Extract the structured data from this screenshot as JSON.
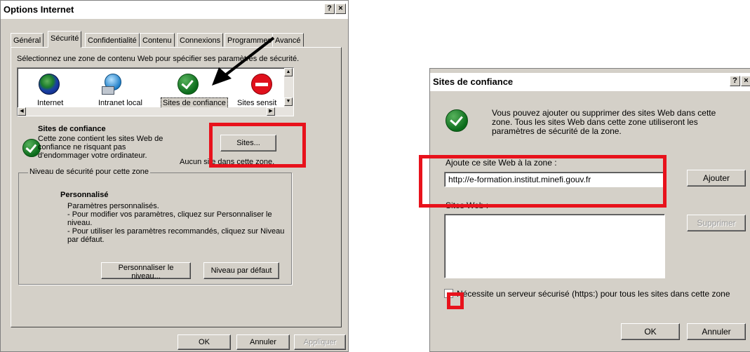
{
  "options_dialog": {
    "title": "Options Internet",
    "help_btn": "?",
    "close_btn": "×",
    "tabs": [
      "Général",
      "Sécurité",
      "Confidentialité",
      "Contenu",
      "Connexions",
      "Programmes",
      "Avancé"
    ],
    "active_tab": "Sécurité",
    "zone_instruction": "Sélectionnez une zone de contenu Web pour spécifier ses paramètres de sécurité.",
    "zones": [
      "Internet",
      "Intranet local",
      "Sites de confiance",
      "Sites sensit"
    ],
    "selected_zone": "Sites de confiance",
    "zone_heading": "Sites de confiance",
    "zone_desc": [
      "Cette zone contient les sites Web de",
      "confiance ne risquant pas",
      "d'endommager votre ordinateur."
    ],
    "sites_button": "Sites...",
    "no_sites_text": "Aucun site dans cette zone.",
    "security_group_label": "Niveau de sécurité pour cette zone",
    "custom_heading": "Personnalisé",
    "custom_lines": [
      "Paramètres personnalisés.",
      "- Pour modifier vos paramètres, cliquez sur Personnaliser le",
      "niveau.",
      "- Pour utiliser les paramètres recommandés, cliquez sur Niveau",
      "par défaut."
    ],
    "customize_button": "Personnaliser le niveau...",
    "default_level_button": "Niveau par défaut",
    "ok_button": "OK",
    "cancel_button": "Annuler",
    "apply_button": "Appliquer"
  },
  "trusted_dialog": {
    "title": "Sites de confiance",
    "help_btn": "?",
    "close_btn": "×",
    "info_lines": [
      "Vous pouvez ajouter ou supprimer des sites Web dans cette",
      "zone. Tous les sites Web dans cette zone utiliseront les",
      "paramètres de sécurité de la zone."
    ],
    "add_label": "Ajoute ce site Web à la zone :",
    "url_value": "http://e-formation.institut.minefi.gouv.fr",
    "add_button": "Ajouter",
    "sites_label": "Sites Web :",
    "remove_button": "Supprimer",
    "https_checkbox_label": "Nécessite un serveur sécurisé (https:) pour tous les sites dans cette zone",
    "https_checked": false,
    "ok_button": "OK",
    "cancel_button": "Annuler"
  },
  "colors": {
    "highlight": "#e8121c",
    "dialog_bg": "#d4d0c8",
    "check_green": "#1a8a2a"
  }
}
